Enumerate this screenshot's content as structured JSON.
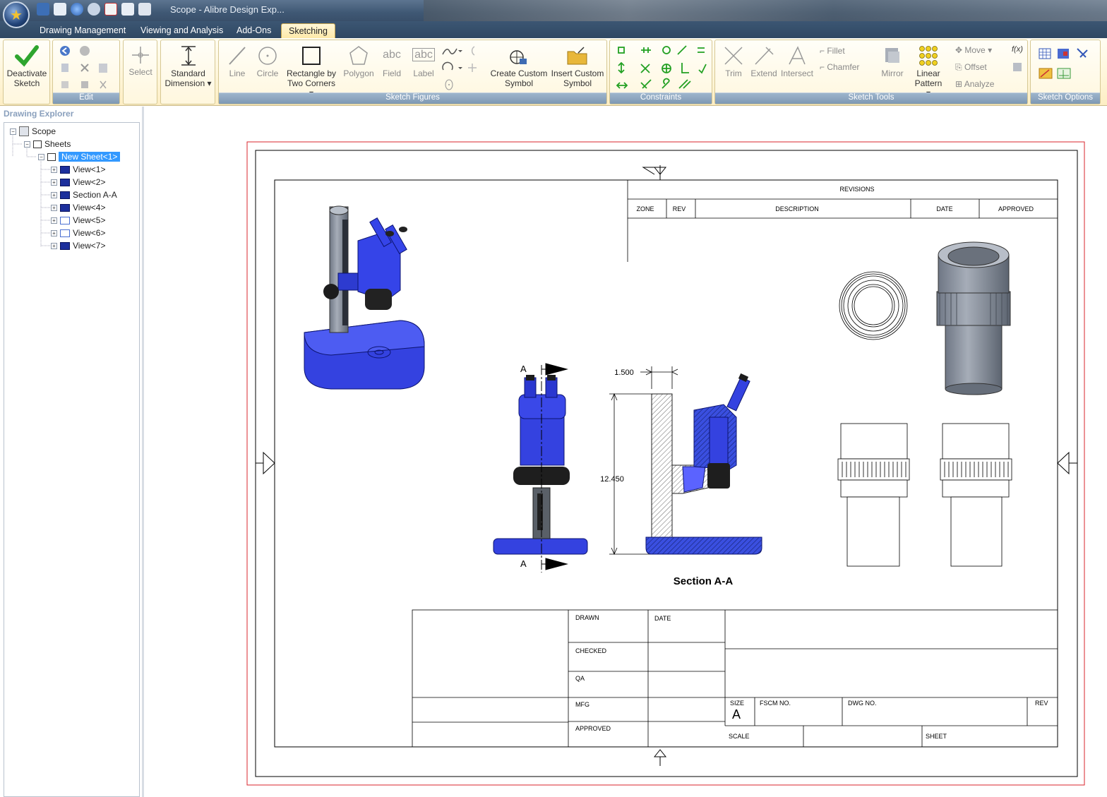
{
  "window": {
    "title": "Scope - Alibre Design Exp..."
  },
  "tabs": [
    {
      "label": "Drawing Management"
    },
    {
      "label": "Viewing and Analysis"
    },
    {
      "label": "Add-Ons"
    },
    {
      "label": "Sketching"
    }
  ],
  "ribbon": {
    "deactivate": "Deactivate Sketch",
    "deactivate_l1": "Deactivate",
    "deactivate_l2": "Sketch",
    "edit_group": "Edit",
    "select": "Select",
    "dimension_l1": "Standard",
    "dimension_l2": "Dimension",
    "line": "Line",
    "circle": "Circle",
    "rect_l1": "Rectangle by",
    "rect_l2": "Two Corners",
    "polygon": "Polygon",
    "field": "Field",
    "label": "Label",
    "create_symbol_l1": "Create Custom",
    "create_symbol_l2": "Symbol",
    "insert_symbol_l1": "Insert Custom",
    "insert_symbol_l2": "Symbol",
    "sketch_figures_group": "Sketch Figures",
    "constraints_group": "Constraints",
    "trim": "Trim",
    "extend": "Extend",
    "intersect": "Intersect",
    "fillet": "Fillet",
    "chamfer": "Chamfer",
    "mirror": "Mirror",
    "linear_pattern_l1": "Linear",
    "linear_pattern_l2": "Pattern",
    "move": "Move",
    "offset": "Offset",
    "analyze": "Analyze",
    "fx": "f(x)",
    "sketch_tools_group": "Sketch Tools",
    "sketch_options_group": "Sketch Options"
  },
  "explorer": {
    "title": "Drawing Explorer",
    "root": "Scope",
    "sheets": "Sheets",
    "sheet": "New Sheet<1>",
    "views": [
      "View<1>",
      "View<2>",
      "Section A-A",
      "View<4>",
      "View<5>",
      "View<6>",
      "View<7>"
    ]
  },
  "drawing": {
    "revisions": "REVISIONS",
    "rev_headers": [
      "ZONE",
      "REV",
      "DESCRIPTION",
      "DATE",
      "APPROVED"
    ],
    "dim_width": "1.500",
    "dim_height": "12.450",
    "section_label": "A",
    "section_caption": "Section A-A",
    "tb_drawn": "DRAWN",
    "tb_date": "DATE",
    "tb_checked": "CHECKED",
    "tb_qa": "QA",
    "tb_mfg": "MFG",
    "tb_approved": "APPROVED",
    "tb_size": "SIZE",
    "tb_size_value": "A",
    "tb_fscm": "FSCM NO.",
    "tb_dwg": "DWG NO.",
    "tb_rev": "REV",
    "tb_scale": "SCALE",
    "tb_sheet": "SHEET"
  }
}
